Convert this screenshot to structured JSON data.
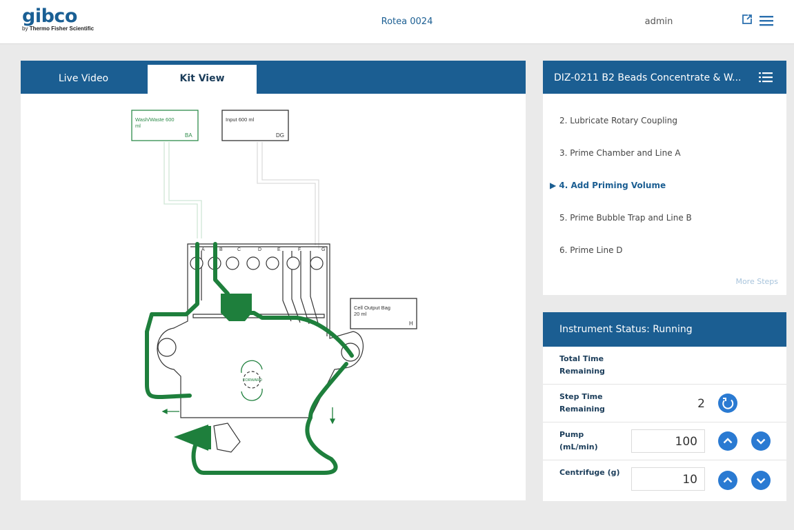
{
  "header": {
    "brand": "gibco",
    "brand_sub_prefix": "by",
    "brand_sub": "Thermo Fisher Scientific",
    "device_name": "Rotea 0024",
    "user": "admin",
    "icons": [
      "export-icon",
      "hamburger-menu-icon"
    ]
  },
  "kit_panel": {
    "tabs": [
      {
        "label": "Live Video",
        "active": false
      },
      {
        "label": "Kit View",
        "active": true
      }
    ],
    "diagram": {
      "bags": {
        "wash_waste": {
          "label_line1": "Wash/Waste 600",
          "label_line2": "ml",
          "port": "BA"
        },
        "input": {
          "label": "Input 600 ml",
          "port": "DG"
        },
        "cell_output": {
          "label_line1": "Cell Output Bag",
          "label_line2": "20 ml",
          "port": "H"
        }
      },
      "valve_letters": [
        "A",
        "B",
        "C",
        "D",
        "E",
        "F",
        "G"
      ],
      "rotation_label": "FORWARD",
      "active_color": "#1e7f3c"
    }
  },
  "protocol": {
    "title": "DIZ-0211 B2 Beads Concentrate & W...",
    "steps": [
      {
        "label": "2.  Lubricate Rotary Coupling",
        "active": false
      },
      {
        "label": "3.  Prime Chamber and Line A",
        "active": false
      },
      {
        "label": "4.  Add Priming Volume",
        "active": true
      },
      {
        "label": "5.  Prime Bubble Trap and Line B",
        "active": false
      },
      {
        "label": "6.  Prime Line D",
        "active": false
      }
    ],
    "active_marker": "▶",
    "more_steps": "More Steps"
  },
  "status": {
    "title": "Instrument Status: Running",
    "rows": {
      "total_time": {
        "label": "Total Time Remaining",
        "value": ""
      },
      "step_time": {
        "label": "Step Time Remaining",
        "value": "2"
      },
      "pump": {
        "label": "Pump (mL/min)",
        "value": "100"
      },
      "centrifuge": {
        "label": "Centrifuge (g)",
        "value": "10"
      }
    }
  },
  "colors": {
    "primary": "#1b5e92",
    "button": "#2a7ad2",
    "active_line": "#1e7f3c"
  }
}
